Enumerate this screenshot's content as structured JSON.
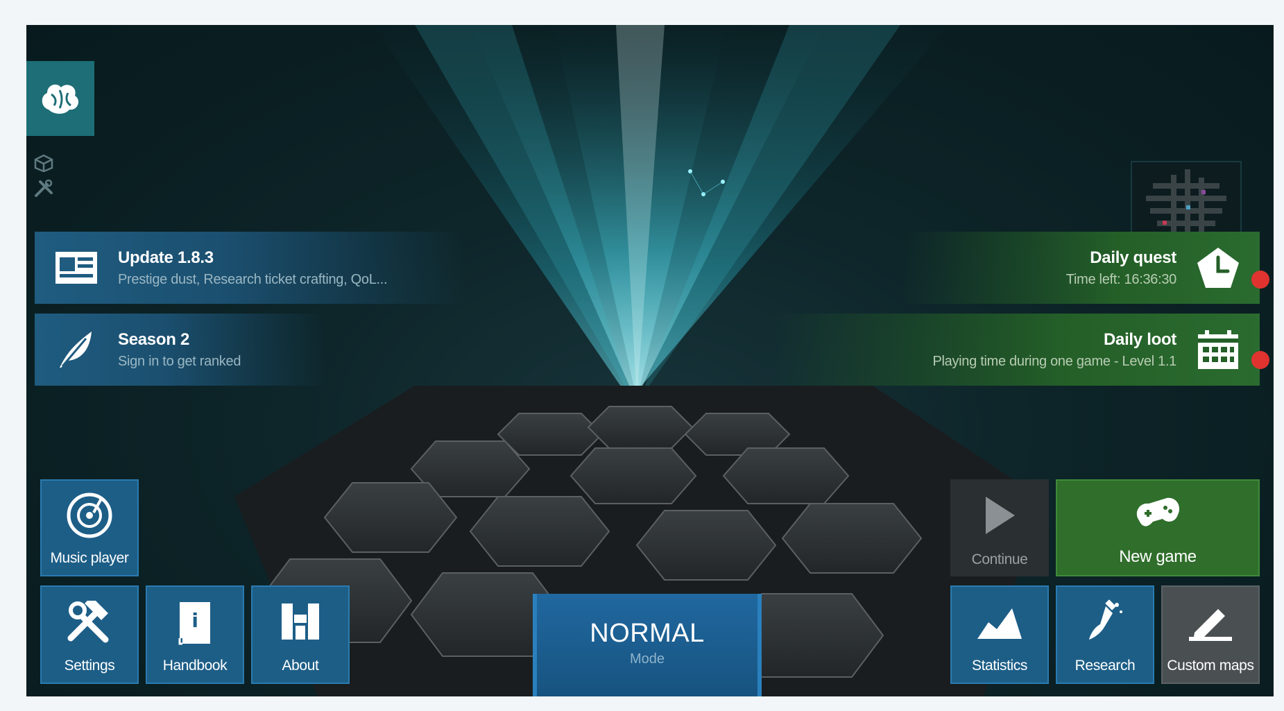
{
  "news": [
    {
      "title": "Update 1.8.3",
      "subtitle": "Prestige dust, Research ticket crafting, QoL...",
      "icon": "newspaper-icon"
    },
    {
      "title": "Season 2",
      "subtitle": "Sign in to get ranked",
      "icon": "feather-icon"
    }
  ],
  "quests": [
    {
      "title": "Daily quest",
      "subtitle": "Time left: 16:36:30",
      "icon": "clock-pentagon-icon",
      "badge": true
    },
    {
      "title": "Daily loot",
      "subtitle": "Playing time during one game - Level 1.1",
      "icon": "calendar-icon",
      "badge": true
    }
  ],
  "menu_left": {
    "music_player": "Music player",
    "settings": "Settings",
    "handbook": "Handbook",
    "about": "About"
  },
  "mode": {
    "title": "NORMAL",
    "subtitle": "Mode"
  },
  "menu_right": {
    "continue": "Continue",
    "new_game": "New game",
    "statistics": "Statistics",
    "research": "Research",
    "custom_maps": "Custom maps"
  },
  "colors": {
    "blue_tile": "#1d5e87",
    "green_tile": "#2f6e2b",
    "gray_tile": "#4a4f52",
    "beam": "#38d6e8",
    "badge": "#e0332f"
  }
}
